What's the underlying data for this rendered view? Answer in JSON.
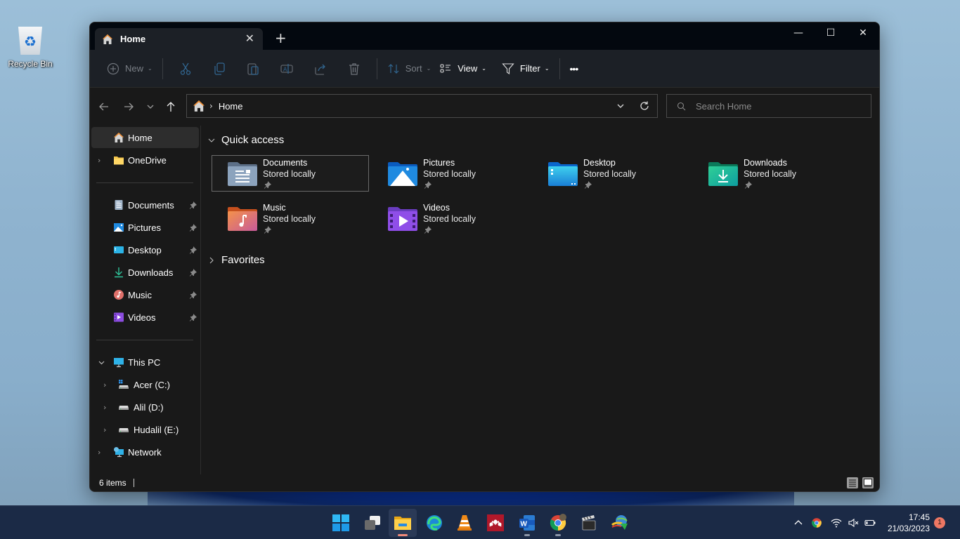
{
  "desktop": {
    "icons": [
      {
        "label": "Recycle Bin",
        "icon": "recycle-bin-icon"
      }
    ]
  },
  "window": {
    "tab": {
      "title": "Home",
      "icon": "home-icon",
      "close_icon": "close-icon"
    },
    "new_tab_icon": "plus-icon",
    "controls": {
      "minimize": "—",
      "maximize": "☐",
      "close": "✕"
    }
  },
  "toolbar": {
    "new_label": "New",
    "sort_label": "Sort",
    "view_label": "View",
    "filter_label": "Filter",
    "more_label": "•••",
    "icons": [
      "cut-icon",
      "copy-icon",
      "paste-icon",
      "rename-icon",
      "share-icon",
      "delete-icon"
    ]
  },
  "nav": {
    "breadcrumb": [
      {
        "label": "Home"
      }
    ],
    "breadcrumb_sep": "›",
    "search_placeholder": "Search Home",
    "search_value": ""
  },
  "sidebar": {
    "items": [
      {
        "label": "Home",
        "icon": "home-icon",
        "selected": true
      },
      {
        "label": "OneDrive",
        "icon": "onedrive-folder-icon",
        "expandable": true
      },
      {
        "label": "Documents",
        "icon": "documents-icon",
        "pinned": true
      },
      {
        "label": "Pictures",
        "icon": "pictures-icon",
        "pinned": true
      },
      {
        "label": "Desktop",
        "icon": "desktop-icon",
        "pinned": true
      },
      {
        "label": "Downloads",
        "icon": "downloads-icon",
        "pinned": true
      },
      {
        "label": "Music",
        "icon": "music-icon",
        "pinned": true
      },
      {
        "label": "Videos",
        "icon": "videos-icon",
        "pinned": true
      },
      {
        "label": "This PC",
        "icon": "this-pc-icon",
        "expanded": true
      },
      {
        "label": "Acer (C:)",
        "icon": "system-drive-icon",
        "expandable": true
      },
      {
        "label": "Alil (D:)",
        "icon": "drive-icon",
        "expandable": true
      },
      {
        "label": "Hudalil (E:)",
        "icon": "drive-icon",
        "expandable": true
      },
      {
        "label": "Network",
        "icon": "network-icon",
        "expandable": true
      }
    ],
    "expand_glyph": "›",
    "expanded_glyph": "⌄"
  },
  "main": {
    "quick_access": {
      "title": "Quick access",
      "items": [
        {
          "name": "Documents",
          "sub": "Stored locally",
          "icon": "documents-folder-icon",
          "selected": true
        },
        {
          "name": "Pictures",
          "sub": "Stored locally",
          "icon": "pictures-folder-icon"
        },
        {
          "name": "Desktop",
          "sub": "Stored locally",
          "icon": "desktop-folder-icon"
        },
        {
          "name": "Downloads",
          "sub": "Stored locally",
          "icon": "downloads-folder-icon"
        },
        {
          "name": "Music",
          "sub": "Stored locally",
          "icon": "music-folder-icon"
        },
        {
          "name": "Videos",
          "sub": "Stored locally",
          "icon": "videos-folder-icon"
        }
      ]
    },
    "favorites": {
      "title": "Favorites"
    }
  },
  "status": {
    "item_count": "6 items"
  },
  "taskbar": {
    "apps": [
      {
        "name": "Start",
        "icon": "windows-start-icon"
      },
      {
        "name": "Task View",
        "icon": "task-view-icon"
      },
      {
        "name": "File Explorer",
        "icon": "file-explorer-icon",
        "active": true
      },
      {
        "name": "Microsoft Edge",
        "icon": "edge-icon"
      },
      {
        "name": "VLC",
        "icon": "vlc-icon"
      },
      {
        "name": "Mendeley",
        "icon": "mendeley-icon"
      },
      {
        "name": "Word",
        "icon": "word-icon",
        "running": true
      },
      {
        "name": "Chrome",
        "icon": "chrome-icon",
        "running": true
      },
      {
        "name": "Video Editor",
        "icon": "clapperboard-icon"
      },
      {
        "name": "Internet Download Manager",
        "icon": "idm-icon"
      }
    ],
    "tray": {
      "icons": [
        "chevron-up-icon",
        "chrome-icon",
        "wifi-icon",
        "speaker-muted-icon",
        "battery-icon"
      ],
      "time": "17:45",
      "date": "21/03/2023",
      "notification_count": "1"
    }
  },
  "colors": {
    "window_bg": "#191919",
    "titlebar_bg": "#03080f",
    "toolbar_bg": "#1c2026",
    "accent_home": "#f08a2c",
    "notif_badge": "#ee7763",
    "taskbar_bg": "#1b2a46"
  }
}
